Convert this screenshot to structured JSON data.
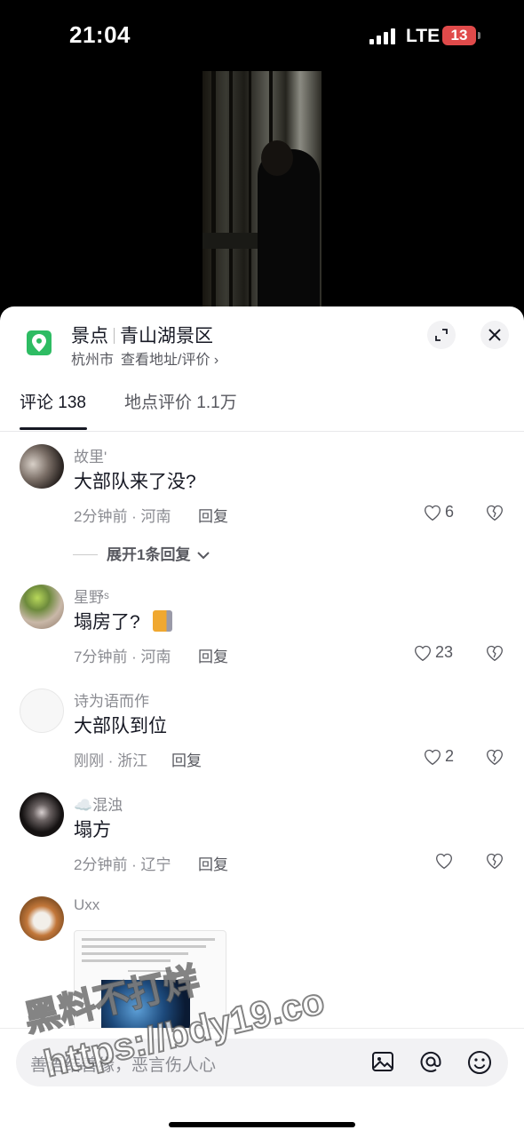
{
  "status_bar": {
    "time": "21:04",
    "network": "LTE",
    "battery": "13"
  },
  "location": {
    "category": "景点",
    "name": "青山湖景区",
    "city": "杭州市",
    "link": "查看地址/评价 ›"
  },
  "tabs": [
    {
      "label": "评论 138",
      "active": true
    },
    {
      "label": "地点评价 1.1万",
      "active": false
    }
  ],
  "comments": [
    {
      "name": "故里'",
      "text": "大部队来了没?",
      "meta": "2分钟前 · 河南",
      "reply": "回复",
      "likes": "6"
    },
    {
      "name": "星野ˢ",
      "text": "塌房了?",
      "meta": "7分钟前 · 河南",
      "reply": "回复",
      "likes": "23"
    },
    {
      "name": "诗为语而作",
      "text": "大部队到位",
      "meta": "刚刚 · 浙江",
      "reply": "回复",
      "likes": "2"
    },
    {
      "name": "☁️混浊",
      "text": "塌方",
      "meta": "2分钟前 · 辽宁",
      "reply": "回复",
      "likes": ""
    },
    {
      "name": "Uxx",
      "text": "",
      "meta": "",
      "reply": "",
      "likes": ""
    }
  ],
  "expand_replies": "展开1条回复",
  "input": {
    "placeholder": "善语结善缘，恶言伤人心"
  },
  "watermark": {
    "line1": "黑料不打烊",
    "line2": "https://bdy19.co"
  },
  "colors": {
    "location_green": "#2ebc63",
    "battery_red": "#e04a4a"
  }
}
